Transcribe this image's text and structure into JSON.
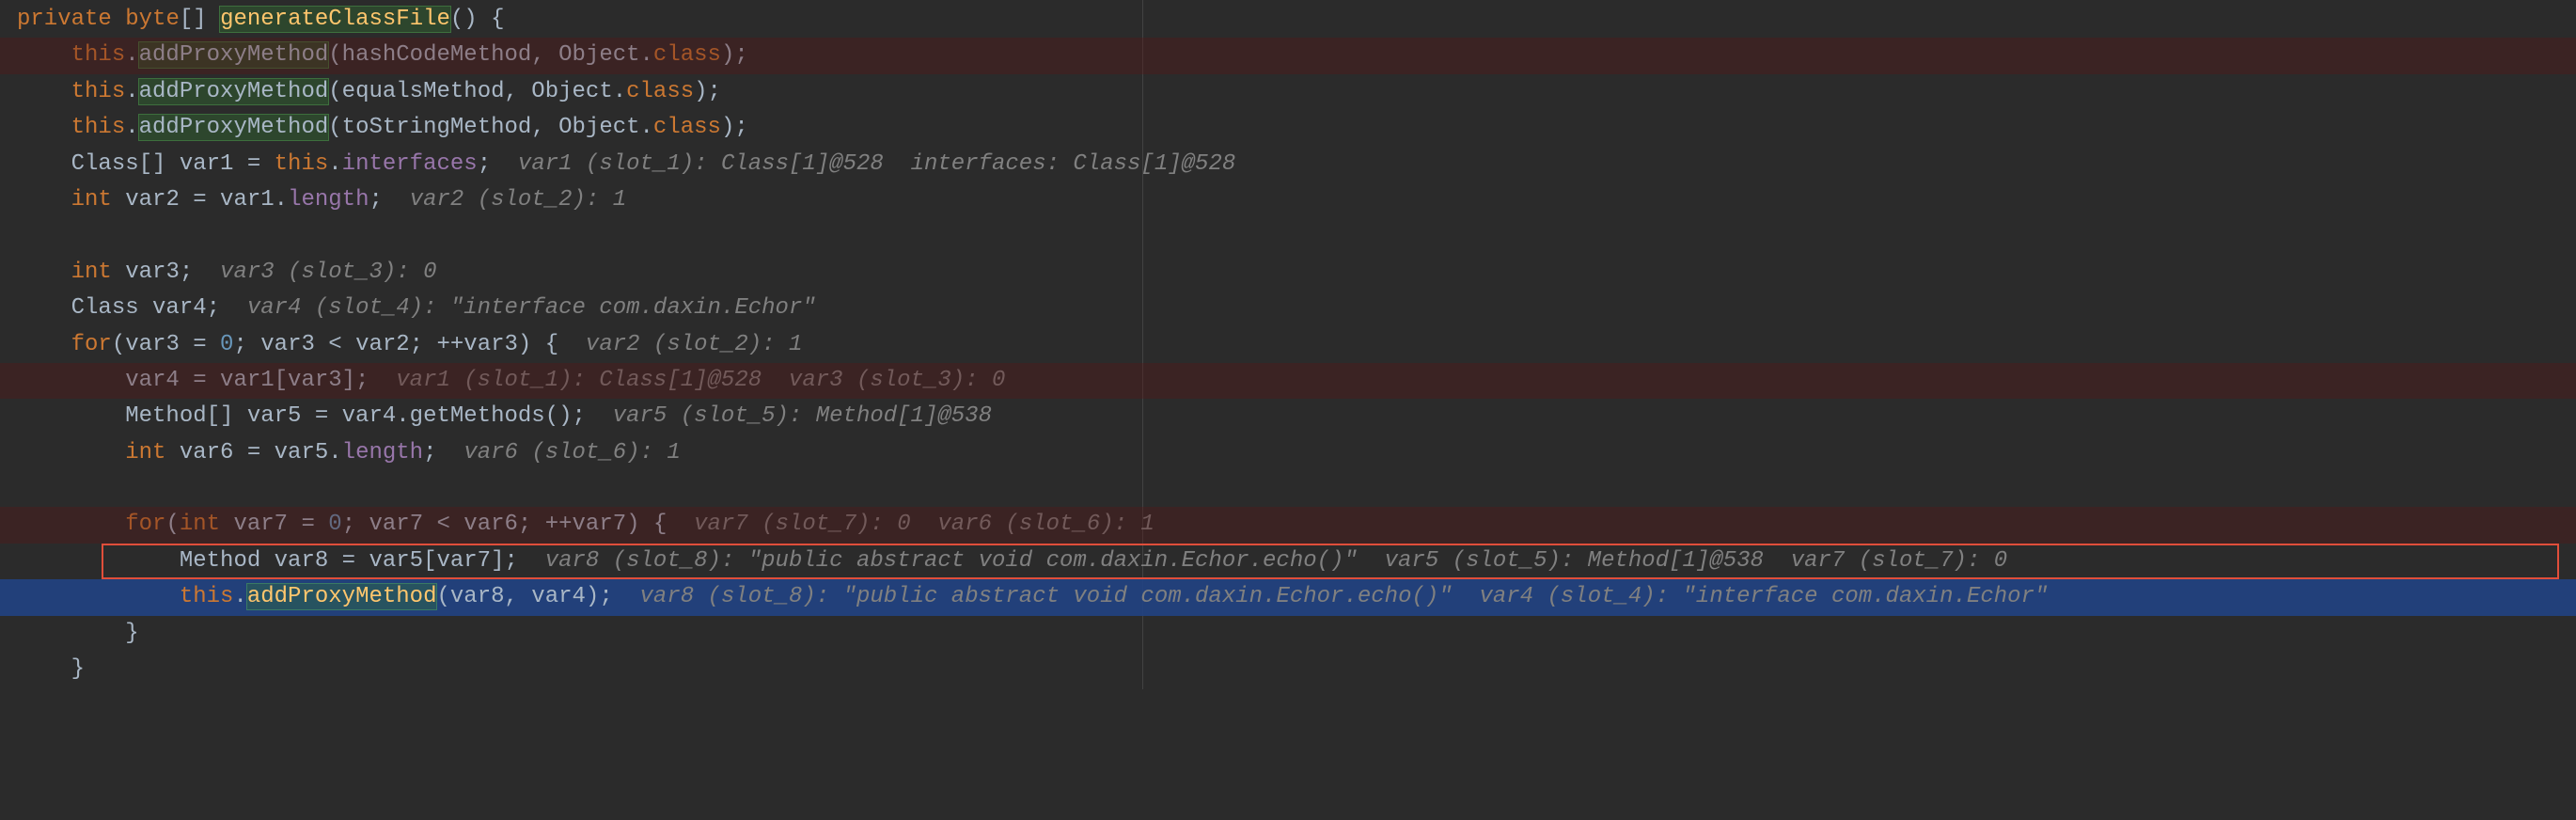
{
  "lines": {
    "l1": {
      "kw1": "private",
      "type": "byte",
      "brackets": "[] ",
      "method": "generateClassFile",
      "paren": "() {"
    },
    "l2": {
      "indent": "    ",
      "this": "this",
      "dot": ".",
      "call": "addProxyMethod",
      "args": "(hashCodeMethod, Object.",
      "cls": "class",
      "end": ");"
    },
    "l3": {
      "indent": "    ",
      "this": "this",
      "dot": ".",
      "call": "addProxyMethod",
      "args": "(equalsMethod, Object.",
      "cls": "class",
      "end": ");"
    },
    "l4": {
      "indent": "    ",
      "this": "this",
      "dot": ".",
      "call": "addProxyMethod",
      "args": "(toStringMethod, Object.",
      "cls": "class",
      "end": ");"
    },
    "l5": {
      "indent": "    ",
      "type": "Class[] var1 = ",
      "this": "this",
      "dot": ".",
      "field": "interfaces",
      "semi": ";  ",
      "comment": "var1 (slot_1): Class[1]@528  interfaces: Class[1]@528"
    },
    "l6": {
      "indent": "    ",
      "kw": "int",
      "body": " var2 = var1.",
      "field": "length",
      "semi": ";  ",
      "comment": "var2 (slot_2): 1"
    },
    "l7": {
      "indent": "    ",
      "kw": "int",
      "body": " var3;  ",
      "comment": "var3 (slot_3): 0"
    },
    "l8": {
      "indent": "    ",
      "type": "Class var4;  ",
      "comment": "var4 (slot_4): \"interface com.daxin.Echor\""
    },
    "l9": {
      "indent": "    ",
      "kw": "for",
      "paren": "(var3 = ",
      "num0": "0",
      "mid": "; var3 < var2; ++var3) {  ",
      "comment": "var2 (slot_2): 1"
    },
    "l10": {
      "indent": "        ",
      "body": "var4 = var1[var3];  ",
      "comment": "var1 (slot_1): Class[1]@528  var3 (slot_3): 0"
    },
    "l11": {
      "indent": "        ",
      "type": "Method[] var5 = var4.getMethods();  ",
      "comment": "var5 (slot_5): Method[1]@538"
    },
    "l12": {
      "indent": "        ",
      "kw": "int",
      "body": " var6 = var5.",
      "field": "length",
      "semi": ";  ",
      "comment": "var6 (slot_6): 1"
    },
    "l13": {
      "indent": "        ",
      "kw": "for",
      "paren": "(",
      "kw2": "int",
      "mid": " var7 = ",
      "num0": "0",
      "mid2": "; var7 < var6; ++var7) {  ",
      "comment": "var7 (slot_7): 0  var6 (slot_6): 1"
    },
    "l14": {
      "indent": "            ",
      "body": "Method var8 = var5[var7];  ",
      "comment": "var8 (slot_8): \"public abstract void com.daxin.Echor.echo()\"  var5 (slot_5): Method[1]@538  var7 (slot_7): 0"
    },
    "l15": {
      "indent": "            ",
      "this": "this",
      "dot": ".",
      "call": "addProxyMethod",
      "args": "(var8, var4);  ",
      "comment": "var8 (slot_8): \"public abstract void com.daxin.Echor.echo()\"  var4 (slot_4): \"interface com.daxin.Echor\""
    },
    "l16": {
      "indent": "        ",
      "brace": "}"
    },
    "l17": {
      "indent": "    ",
      "brace": "}"
    }
  }
}
